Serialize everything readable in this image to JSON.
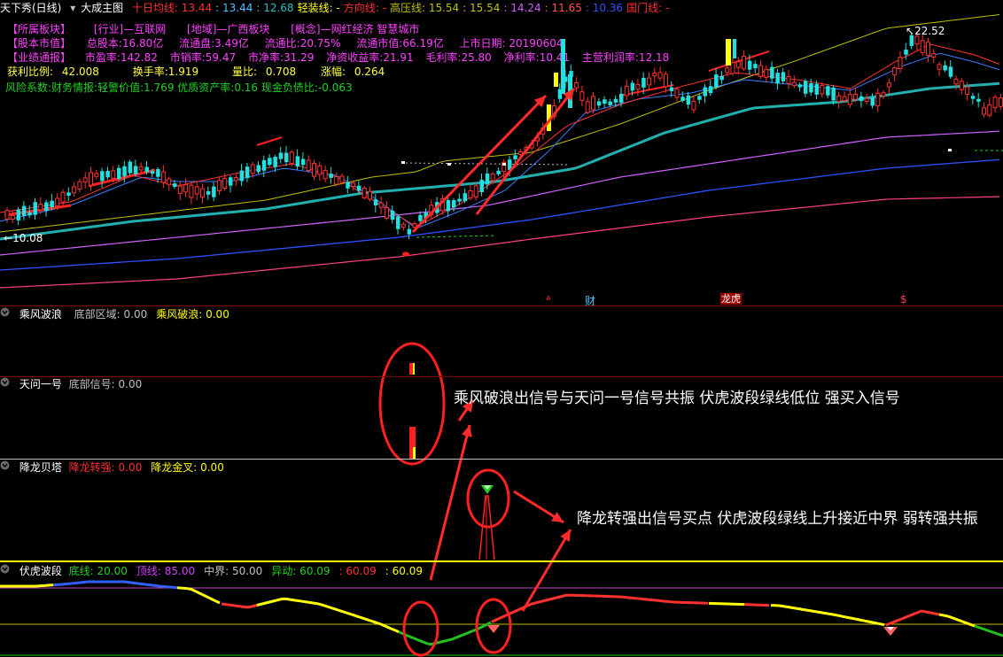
{
  "title_bar": {
    "stock_title": "天下秀(日线)",
    "chart_name": "大成主图",
    "indicators": [
      {
        "label": "十日均线:",
        "value": "13.44",
        "color": "#ff3030"
      },
      {
        "label": "",
        "value": "13.44",
        "color": "#4fc3ff"
      },
      {
        "label": "",
        "value": "12.68",
        "color": "#20c0c0"
      },
      {
        "label": "轻装线:",
        "value": "-",
        "color": "#ffff00"
      },
      {
        "label": "方向线:",
        "value": "-",
        "color": "#ff3030"
      },
      {
        "label": "高压线:",
        "value": "15.54",
        "color": "#c0c000"
      },
      {
        "label": "",
        "value": "15.54",
        "color": "#c0c000"
      },
      {
        "label": "",
        "value": "14.24",
        "color": "#d060ff"
      },
      {
        "label": "",
        "value": "11.65",
        "color": "#ff5050"
      },
      {
        "label": "",
        "value": "10.36",
        "color": "#3050ff"
      },
      {
        "label": "国门线:",
        "value": "-",
        "color": "#ff3030"
      }
    ]
  },
  "info": {
    "line1": [
      "【所属板块】",
      "[行业]—互联网",
      "[地域]—广西板块",
      "[概念]—网红经济 智慧城市"
    ],
    "line2": [
      "【股本市值】",
      "总股本:16.80亿",
      "流通盘:3.49亿",
      "流通比:20.75%",
      "流通市值:66.19亿",
      "上市日期: 20190604"
    ],
    "line3": [
      "【业绩通报】",
      "市盈率:142.82",
      "市销率:59.47",
      "市净率:31.29",
      "净资收益率:21.91",
      "毛利率:25.80",
      "净利率:10.41",
      "主营利润率:12.18"
    ],
    "line4": [
      {
        "label": "获利比例:",
        "value": "42.008"
      },
      {
        "label": "换手率:",
        "value": "1.919"
      },
      {
        "label": "量比:",
        "value": "0.708"
      },
      {
        "label": "涨幅:",
        "value": "0.264"
      }
    ],
    "line5": "风险系数:财务情报:轻警价值:1.769 优质资产率:0.16 现金负债比:-0.063"
  },
  "price_labels": {
    "high": "22.52",
    "low": "10.08"
  },
  "event_markers": {
    "finance": "财",
    "ranking": "龙虎",
    "dollar": "$"
  },
  "panels": {
    "p1": {
      "name": "乘风波浪",
      "items": [
        {
          "label": "底部区域:",
          "value": "0.00",
          "color": "#c0c0c0"
        },
        {
          "label": "乘风破浪:",
          "value": "0.00",
          "color": "#ffff00"
        }
      ]
    },
    "p2": {
      "name": "天问一号",
      "items": [
        {
          "label": "底部信号:",
          "value": "0.00",
          "color": "#c0c0c0"
        }
      ]
    },
    "p3": {
      "name": "降龙贝塔",
      "items": [
        {
          "label": "降龙转强:",
          "value": "0.00",
          "color": "#ff3030"
        },
        {
          "label": "降龙金叉:",
          "value": "0.00",
          "color": "#ffff00"
        }
      ]
    },
    "p4": {
      "name": "伏虎波段",
      "items": [
        {
          "label": "底线:",
          "value": "20.00",
          "color": "#20d020"
        },
        {
          "label": "顶线:",
          "value": "85.00",
          "color": "#d040ff"
        },
        {
          "label": "中界:",
          "value": "50.00",
          "color": "#c0c0c0"
        },
        {
          "label": "异动:",
          "value": "60.09",
          "color": "#20d020"
        },
        {
          "label": ":",
          "value": "60.09",
          "color": "#ff3030"
        },
        {
          "label": ":",
          "value": "60.09",
          "color": "#ffff00"
        }
      ]
    }
  },
  "annotations": {
    "a1": "乘风破浪出信号与天问一号信号共振 伏虎波段绿线低位 强买入信号",
    "a2": "降龙转强出信号买点 伏虎波段绿线上升接近中界 弱转强共振"
  },
  "colors": {
    "bg": "#000000",
    "up": "#ff3030",
    "down": "#20e0e0",
    "sep": "#7a0000",
    "annotation": "#ff2020"
  }
}
